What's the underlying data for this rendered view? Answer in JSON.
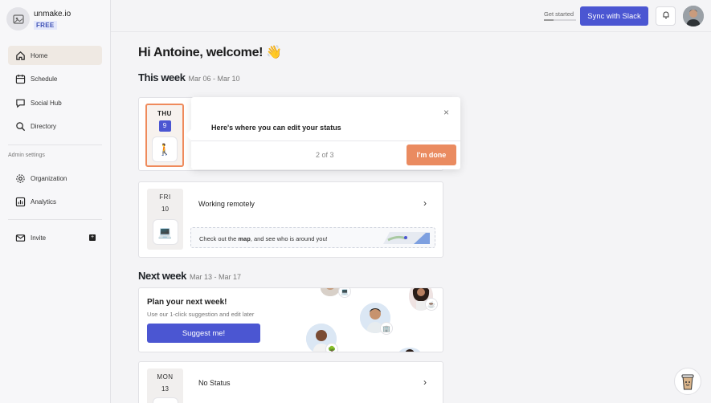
{
  "workspace": {
    "name": "unmake.io",
    "plan": "FREE"
  },
  "sidebar": {
    "items": [
      {
        "label": "Home",
        "icon": "home-icon"
      },
      {
        "label": "Schedule",
        "icon": "calendar-icon"
      },
      {
        "label": "Social Hub",
        "icon": "chat-icon"
      },
      {
        "label": "Directory",
        "icon": "search-icon"
      }
    ],
    "admin_section": "Admin settings",
    "admin_items": [
      {
        "label": "Organization",
        "icon": "gear-icon"
      },
      {
        "label": "Analytics",
        "icon": "chart-icon"
      }
    ],
    "invite": "Invite"
  },
  "topbar": {
    "get_started": "Get started",
    "get_started_progress": 0.3,
    "sync_button": "Sync with Slack"
  },
  "main": {
    "greeting": "Hi Antoine, welcome! 👋",
    "this_week": {
      "title": "This week",
      "range": "Mar 06 - Mar 10"
    },
    "next_week": {
      "title": "Next week",
      "range": "Mar 13 - Mar 17"
    },
    "days": [
      {
        "name": "THU",
        "date": "9",
        "emoji": "🚶"
      },
      {
        "name": "FRI",
        "date": "10",
        "emoji": "💻",
        "status": "Working remotely",
        "map_prefix": "Check out the ",
        "map_link": "map",
        "map_suffix": ", and see who is around you!"
      },
      {
        "name": "MON",
        "date": "13",
        "status": "No Status"
      }
    ],
    "plan": {
      "title": "Plan your next week!",
      "subtitle": "Use our 1-click suggestion and edit later",
      "button": "Suggest me!"
    }
  },
  "popover": {
    "title": "Here's where you can edit your status",
    "step": "2 of 3",
    "done": "I'm done",
    "close": "×"
  },
  "colors": {
    "accent": "#4b56d2",
    "highlight": "#ea8b60"
  }
}
